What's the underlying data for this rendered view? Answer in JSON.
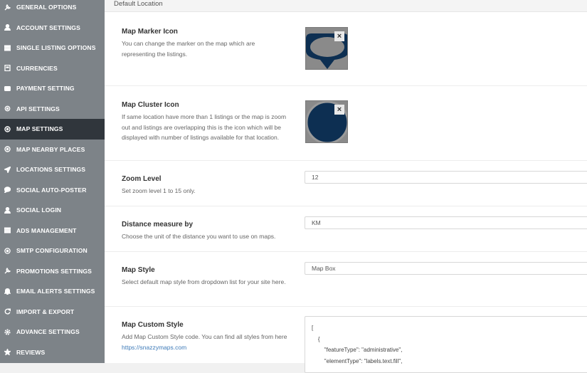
{
  "sidebar": {
    "items": [
      {
        "label": "GENERAL OPTIONS",
        "icon": "wrench-icon",
        "active": false
      },
      {
        "label": "ACCOUNT SETTINGS",
        "icon": "user-icon",
        "active": false
      },
      {
        "label": "SINGLE LISTING OPTIONS",
        "icon": "list-icon",
        "active": false
      },
      {
        "label": "CURRENCIES",
        "icon": "currency-icon",
        "active": false
      },
      {
        "label": "PAYMENT SETTING",
        "icon": "card-icon",
        "active": false
      },
      {
        "label": "API SETTINGS",
        "icon": "api-icon",
        "active": false
      },
      {
        "label": "MAP SETTINGS",
        "icon": "map-pin-icon",
        "active": true
      },
      {
        "label": "MAP NEARBY PLACES",
        "icon": "target-icon",
        "active": false
      },
      {
        "label": "LOCATIONS SETTINGS",
        "icon": "location-arrow-icon",
        "active": false
      },
      {
        "label": "SOCIAL AUTO-POSTER",
        "icon": "chat-icon",
        "active": false
      },
      {
        "label": "SOCIAL LOGIN",
        "icon": "user-icon",
        "active": false
      },
      {
        "label": "ADS MANAGEMENT",
        "icon": "list-icon",
        "active": false
      },
      {
        "label": "SMTP CONFIGURATION",
        "icon": "at-icon",
        "active": false
      },
      {
        "label": "PROMOTIONS SETTINGS",
        "icon": "wrench-icon",
        "active": false
      },
      {
        "label": "EMAIL ALERTS SETTINGS",
        "icon": "bell-icon",
        "active": false
      },
      {
        "label": "IMPORT & EXPORT",
        "icon": "refresh-icon",
        "active": false
      },
      {
        "label": "ADVANCE SETTINGS",
        "icon": "gear-icon",
        "active": false
      },
      {
        "label": "REVIEWS",
        "icon": "star-icon",
        "active": false
      }
    ]
  },
  "header": {
    "title": "Default Location"
  },
  "settings": {
    "marker": {
      "label": "Map Marker Icon",
      "desc": "You can change the marker on the map which are representing the listings."
    },
    "cluster": {
      "label": "Map Cluster Icon",
      "desc": "If same location have more than 1 listings or the map is zoom out and listings are overlapping this is the icon which will be displayed with number of listings available for that location."
    },
    "zoom": {
      "label": "Zoom Level",
      "desc": "Set zoom level 1 to 15 only.",
      "value": "12"
    },
    "distance": {
      "label": "Distance measure by",
      "desc": "Choose the unit of the distance you want to use on maps.",
      "value": "KM"
    },
    "style": {
      "label": "Map Style",
      "desc": "Select default map style from dropdown list for your site here.",
      "value": "Map Box"
    },
    "custom": {
      "label": "Map Custom Style",
      "desc": "Add Map Custom Style code. You can find all styles from here",
      "link": "https://snazzymaps.com",
      "code": [
        "[",
        "    {",
        "        \"featureType\": \"administrative\",",
        "        \"elementType\": \"labels.text.fill\","
      ]
    }
  },
  "close_glyph": "×",
  "colors": {
    "sidebar": "#7d8388",
    "active": "#30363c",
    "marker": "#0d2f52",
    "link": "#3d7ab8"
  }
}
